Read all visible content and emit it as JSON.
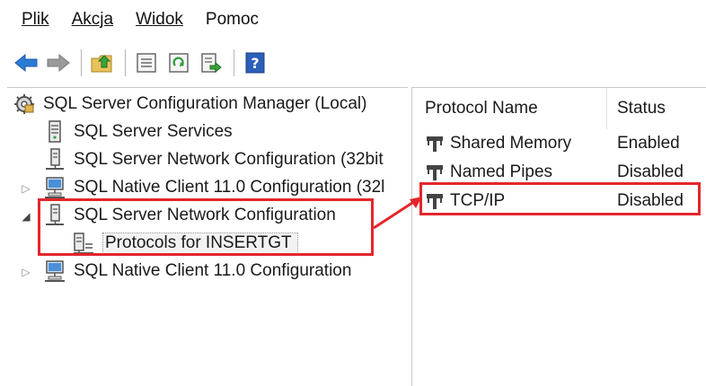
{
  "menu": [
    {
      "label": "Plik"
    },
    {
      "label": "Akcja"
    },
    {
      "label": "Widok"
    },
    {
      "label": "Pomoc"
    }
  ],
  "tree": {
    "root": "SQL Server Configuration Manager (Local)",
    "items": [
      {
        "label": "SQL Server Services"
      },
      {
        "label": "SQL Server Network Configuration (32bit"
      },
      {
        "label": "SQL Native Client 11.0 Configuration (32l"
      },
      {
        "label": "SQL Server Network Configuration"
      },
      {
        "label": "Protocols for INSERTGT"
      },
      {
        "label": "SQL Native Client 11.0 Configuration"
      }
    ]
  },
  "list": {
    "columns": [
      "Protocol Name",
      "Status"
    ],
    "rows": [
      {
        "name": "Shared Memory",
        "status": "Enabled"
      },
      {
        "name": "Named Pipes",
        "status": "Disabled"
      },
      {
        "name": "TCP/IP",
        "status": "Disabled"
      }
    ]
  },
  "colors": {
    "highlight": "#e3262b",
    "nav_arrow": "#2b7bd6"
  },
  "icons": {
    "toolbar": [
      "back-arrow-icon",
      "forward-arrow-icon",
      "up-folder-icon",
      "properties-icon",
      "refresh-icon",
      "export-list-icon",
      "help-icon"
    ],
    "tree": [
      "config-manager-icon",
      "server-icon",
      "network-config-icon",
      "client-icon",
      "protocols-icon"
    ],
    "list": [
      "protocol-icon"
    ]
  }
}
